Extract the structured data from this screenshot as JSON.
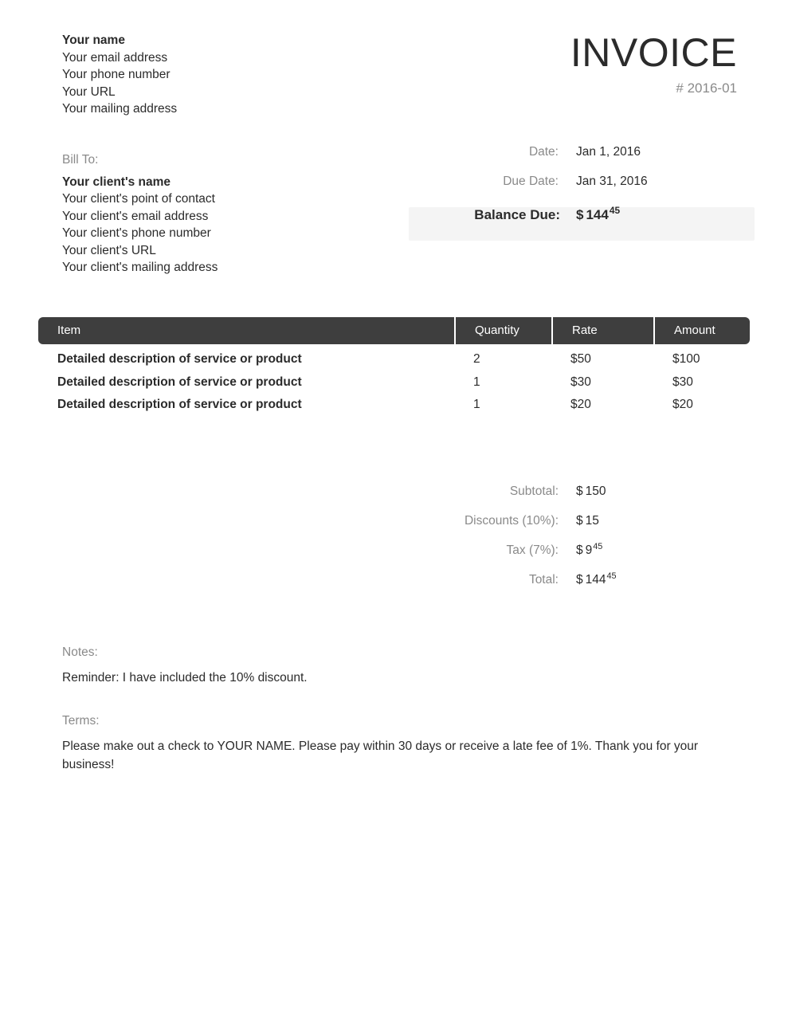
{
  "document": {
    "title": "INVOICE",
    "number": "# 2016-01"
  },
  "sender": {
    "name": "Your name",
    "email": "Your email address",
    "phone": "Your phone number",
    "url": "Your URL",
    "address": "Your mailing address"
  },
  "bill_to": {
    "label": "Bill To:",
    "client_name": "Your client's name",
    "contact": "Your client's point of contact",
    "email": "Your client's email address",
    "phone": "Your client's phone number",
    "url": "Your client's URL",
    "address": "Your client's mailing address"
  },
  "meta": {
    "date_label": "Date:",
    "date_value": "Jan 1, 2016",
    "due_date_label": "Due Date:",
    "due_date_value": "Jan 31, 2016",
    "balance_due_label": "Balance Due:",
    "balance_due_currency": "$",
    "balance_due_whole": "144",
    "balance_due_cents": "45"
  },
  "items_table": {
    "columns": [
      "Item",
      "Quantity",
      "Rate",
      "Amount"
    ],
    "rows": [
      {
        "item": "Detailed description of service or product",
        "quantity": "2",
        "rate": "$50",
        "amount": "$100"
      },
      {
        "item": "Detailed description of service or product",
        "quantity": "1",
        "rate": "$30",
        "amount": "$30"
      },
      {
        "item": "Detailed description of service or product",
        "quantity": "1",
        "rate": "$20",
        "amount": "$20"
      }
    ]
  },
  "totals": {
    "subtotal_label": "Subtotal:",
    "subtotal_currency": "$",
    "subtotal_whole": "150",
    "subtotal_cents": "",
    "discounts_label": "Discounts (10%):",
    "discounts_currency": "$",
    "discounts_whole": "15",
    "discounts_cents": "",
    "tax_label": "Tax (7%):",
    "tax_currency": "$",
    "tax_whole": "9",
    "tax_cents": "45",
    "total_label": "Total:",
    "total_currency": "$",
    "total_whole": "144",
    "total_cents": "45"
  },
  "notes": {
    "label": "Notes:",
    "text": "Reminder: I have included the 10% discount."
  },
  "terms": {
    "label": "Terms:",
    "text": "Please make out a check to YOUR NAME. Please pay within 30 days or receive a late fee of 1%. Thank you for your business!"
  },
  "colors": {
    "table_header_bg": "#3e3e3e",
    "balance_band_bg": "#f4f4f4",
    "muted_text": "#8a8a8a",
    "body_text": "#2b2b2b"
  }
}
